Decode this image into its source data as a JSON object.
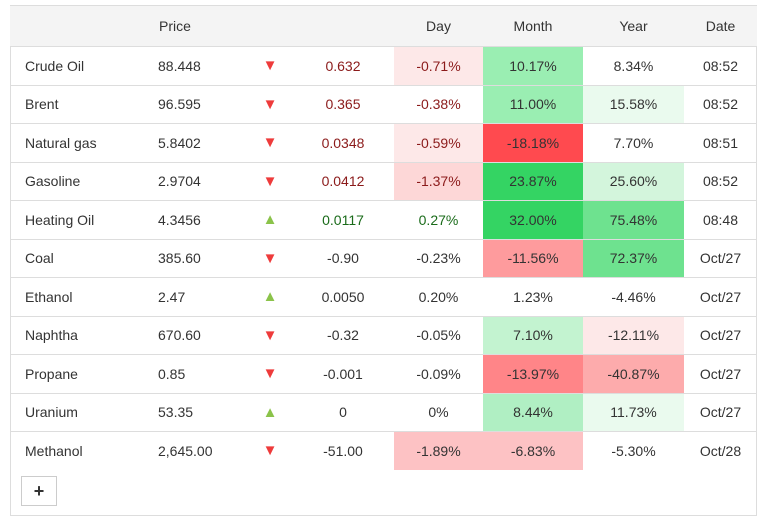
{
  "headers": {
    "name": "",
    "price": "Price",
    "arrow": "",
    "change": "",
    "day": "Day",
    "month": "Month",
    "year": "Year",
    "date": "Date"
  },
  "rows": [
    {
      "name": "Crude Oil",
      "price": "88.448",
      "dir": "down",
      "change": "0.632",
      "day": "-0.71%",
      "month": "10.17%",
      "year": "8.34%",
      "date": "08:52",
      "text": "red",
      "bg": [
        "#fde8e8",
        "#9aeeb2",
        "#ffffff"
      ]
    },
    {
      "name": "Brent",
      "price": "96.595",
      "dir": "down",
      "change": "0.365",
      "day": "-0.38%",
      "month": "11.00%",
      "year": "15.58%",
      "date": "08:52",
      "text": "red",
      "bg": [
        "#ffffff",
        "#9aeeb2",
        "#eafaee"
      ]
    },
    {
      "name": "Natural gas",
      "price": "5.8402",
      "dir": "down",
      "change": "0.0348",
      "day": "-0.59%",
      "month": "-18.18%",
      "year": "7.70%",
      "date": "08:51",
      "text": "red",
      "bg": [
        "#fde8e8",
        "#ff4a4f",
        "#ffffff"
      ]
    },
    {
      "name": "Gasoline",
      "price": "2.9704",
      "dir": "down",
      "change": "0.0412",
      "day": "-1.37%",
      "month": "23.87%",
      "year": "25.60%",
      "date": "08:52",
      "text": "red",
      "bg": [
        "#fdd7d7",
        "#34d463",
        "#d3f5dc"
      ]
    },
    {
      "name": "Heating Oil",
      "price": "4.3456",
      "dir": "up",
      "change": "0.0117",
      "day": "0.27%",
      "month": "32.00%",
      "year": "75.48%",
      "date": "08:48",
      "text": "green",
      "bg": [
        "#ffffff",
        "#34d463",
        "#6ee28f"
      ]
    },
    {
      "name": "Coal",
      "price": "385.60",
      "dir": "down",
      "change": "-0.90",
      "day": "-0.23%",
      "month": "-11.56%",
      "year": "72.37%",
      "date": "Oct/27",
      "text": "",
      "bg": [
        "#ffffff",
        "#fe9b9d",
        "#6ee28f"
      ]
    },
    {
      "name": "Ethanol",
      "price": "2.47",
      "dir": "up",
      "change": "0.0050",
      "day": "0.20%",
      "month": "1.23%",
      "year": "-4.46%",
      "date": "Oct/27",
      "text": "",
      "bg": [
        "#ffffff",
        "#ffffff",
        "#ffffff"
      ]
    },
    {
      "name": "Naphtha",
      "price": "670.60",
      "dir": "down",
      "change": "-0.32",
      "day": "-0.05%",
      "month": "7.10%",
      "year": "-12.11%",
      "date": "Oct/27",
      "text": "",
      "bg": [
        "#ffffff",
        "#c3f3d0",
        "#fde8e8"
      ]
    },
    {
      "name": "Propane",
      "price": "0.85",
      "dir": "down",
      "change": "-0.001",
      "day": "-0.09%",
      "month": "-13.97%",
      "year": "-40.87%",
      "date": "Oct/27",
      "text": "",
      "bg": [
        "#ffffff",
        "#ff8588",
        "#fdabac"
      ]
    },
    {
      "name": "Uranium",
      "price": "53.35",
      "dir": "up",
      "change": "0",
      "day": "0%",
      "month": "8.44%",
      "year": "11.73%",
      "date": "Oct/27",
      "text": "",
      "bg": [
        "#ffffff",
        "#b0efc3",
        "#eafaee"
      ]
    },
    {
      "name": "Methanol",
      "price": "2,645.00",
      "dir": "down",
      "change": "-51.00",
      "day": "-1.89%",
      "month": "-6.83%",
      "year": "-5.30%",
      "date": "Oct/28",
      "text": "",
      "bg": [
        "#fdc2c4",
        "#fdc2c4",
        "#ffffff"
      ]
    }
  ],
  "add_button": {
    "label": "+"
  },
  "colors": {
    "up": "#8bc34a",
    "down": "#ee3b3b"
  }
}
